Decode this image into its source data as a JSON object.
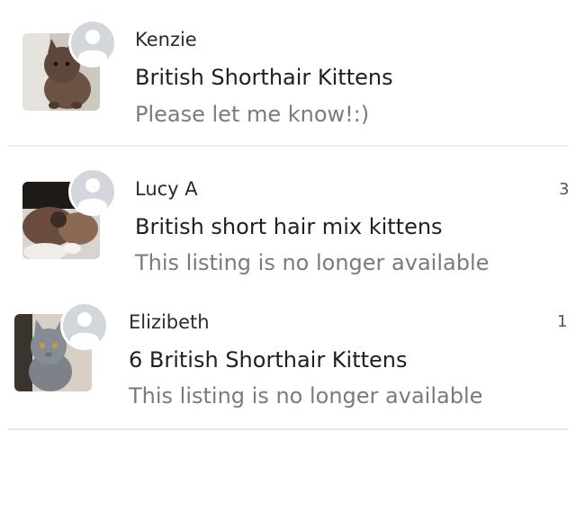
{
  "conversations": [
    {
      "sender": "Kenzie",
      "listing_title": "British Shorthair Kittens",
      "last_message": "Please let me know!:)",
      "unread_count": "",
      "thumbnail": "kitten-photo-brown",
      "avatar": "default-user-icon"
    },
    {
      "sender": "Lucy A",
      "listing_title": "British short hair mix kittens",
      "last_message": "This listing is no longer available",
      "unread_count": "3",
      "thumbnail": "kittens-photo-mixed",
      "avatar": "default-user-icon"
    },
    {
      "sender": "Elizibeth",
      "listing_title": "6 British Shorthair Kittens",
      "last_message": "This listing is no longer available",
      "unread_count": "1",
      "thumbnail": "kitten-photo-grey",
      "avatar": "default-user-icon"
    }
  ],
  "colors": {
    "divider": "#ececec",
    "avatar_bg": "#d3d6da",
    "avatar_figure": "#ffffff",
    "name_text": "#2b2b2b",
    "title_text": "#1f1f1f",
    "message_text": "#7b7b7b"
  }
}
